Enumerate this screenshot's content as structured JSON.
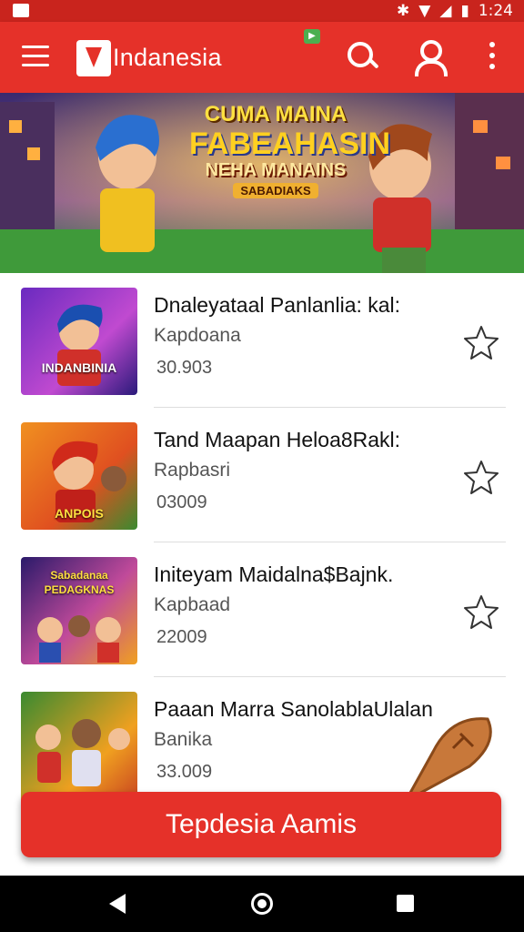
{
  "status_bar": {
    "time": "1:24"
  },
  "app_bar": {
    "title": "Indanesia"
  },
  "banner": {
    "line1": "CUMA MAINA",
    "line2": "FABEAHASIN",
    "line3": "NEHA MANAINS",
    "line4": "SABADIAKS"
  },
  "items": [
    {
      "title": "Dnaleyataal Panlanlia: kal:",
      "subtitle": "Kapdoana",
      "count": "30.903",
      "thumb_label": "INDANBINIA"
    },
    {
      "title": "Tand Maapan Heloa8Rakl:",
      "subtitle": "Rapbasri",
      "count": "03009",
      "thumb_label": "ANPOIS"
    },
    {
      "title": "Initeyam Maidalna$Bajnk.",
      "subtitle": "Kapbaad",
      "count": "22009",
      "thumb_label": "Sabadanaa PEDAGKNAS"
    },
    {
      "title": "Paaan Marra SanolablaUlalan",
      "subtitle": "Banika",
      "count": "33.009",
      "thumb_label": ""
    }
  ],
  "cta": {
    "label": "Tepdesia Aamis"
  },
  "colors": {
    "primary": "#e53129",
    "status_bar": "#c9241d"
  },
  "icons": [
    "menu-icon",
    "logo-icon",
    "search-icon",
    "user-icon",
    "more-icon",
    "star-icon",
    "back-icon",
    "home-icon",
    "recents-icon"
  ]
}
